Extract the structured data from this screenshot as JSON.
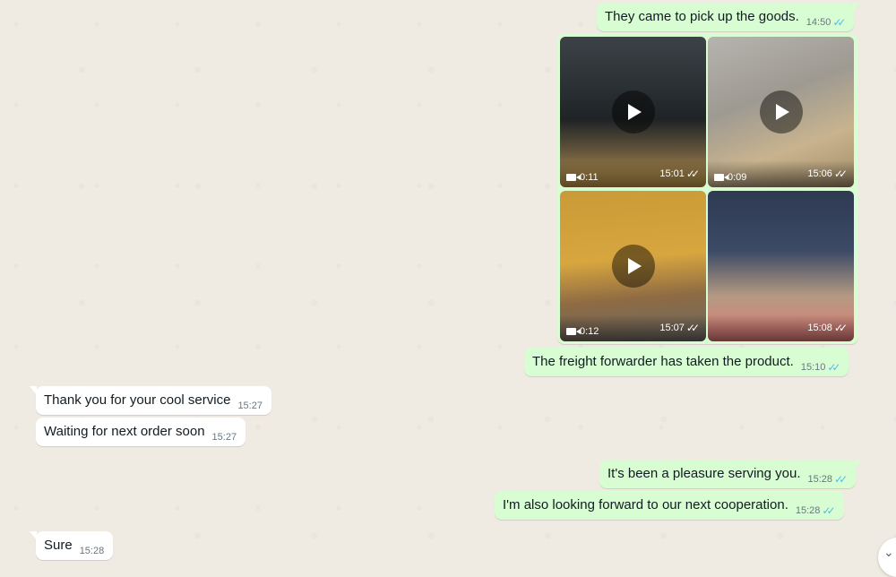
{
  "messages": [
    {
      "text": "They came to pick up the goods.",
      "time": "14:50"
    },
    {
      "text": "The freight forwarder has taken the product.",
      "time": "15:10"
    },
    {
      "text": "Thank you for your cool service",
      "time": "15:27"
    },
    {
      "text": "Waiting for next order soon",
      "time": "15:27"
    },
    {
      "text": "It's been a pleasure serving you.",
      "time": "15:28"
    },
    {
      "text": "I'm also looking forward to our next cooperation.",
      "time": "15:28"
    },
    {
      "text": "Sure",
      "time": "15:28"
    }
  ],
  "media": [
    {
      "duration": "0:11",
      "time": "15:01"
    },
    {
      "duration": "0:09",
      "time": "15:06"
    },
    {
      "duration": "0:12",
      "time": "15:07"
    },
    {
      "time": "15:08"
    }
  ],
  "icons": {
    "ticks": "double-check-icon",
    "play": "play-icon",
    "camera": "video-camera-icon",
    "scroll": "chevron-down-icon"
  },
  "colors": {
    "outgoing": "#d9fdd3",
    "incoming": "#ffffff",
    "read_ticks": "#53bdeb",
    "background": "#efeae2"
  }
}
